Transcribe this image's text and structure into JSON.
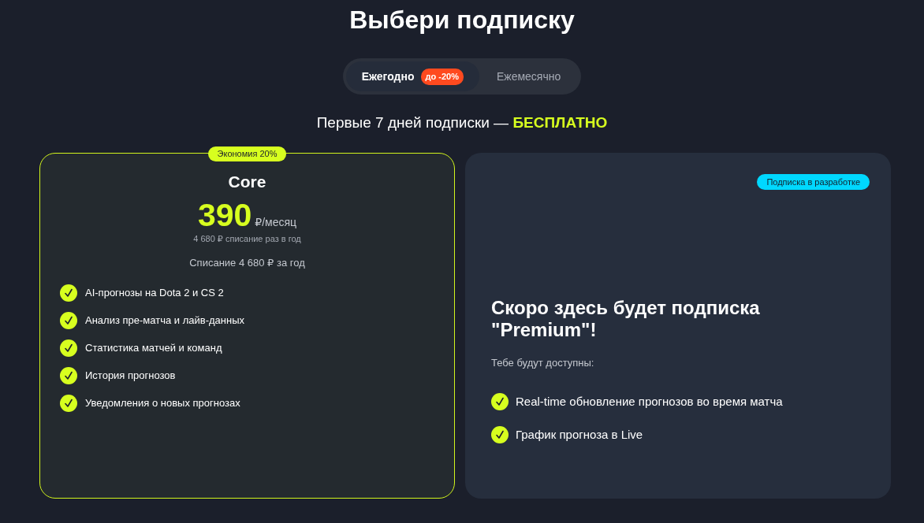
{
  "title": "Выбери подписку",
  "billing_toggle": {
    "tabs": [
      {
        "label": "Ежегодно",
        "badge": "до -20%",
        "selected": true
      },
      {
        "label": "Ежемесячно",
        "selected": false
      }
    ]
  },
  "trial_note": "Первые 7 дней подписки — **БЕСПЛАТНО**",
  "plans": [
    {
      "kind": "available",
      "highlighted": true,
      "badge": "Экономия 20%",
      "name": "Core",
      "price": "390",
      "price_unit": "₽/месяц",
      "price_note": "4 680 ₽ списание раз в год",
      "billing_note": "Списание 4 680 ₽ за год",
      "features": [
        "AI-прогнозы на Dota 2 и CS 2",
        "Анализ пре-матча и лайв-данных",
        "Статистика матчей и команд",
        "История прогнозов",
        "Уведомления о новых прогнозах"
      ]
    },
    {
      "kind": "coming_soon",
      "highlighted": false,
      "badge": "Подписка в разработке",
      "heading": "Скоро здесь будет подписка \"Premium\"!",
      "subheading": "Тебе будут доступны:",
      "features": [
        "Real-time обновление прогнозов во время матча",
        "График прогноза в Live"
      ]
    }
  ]
}
